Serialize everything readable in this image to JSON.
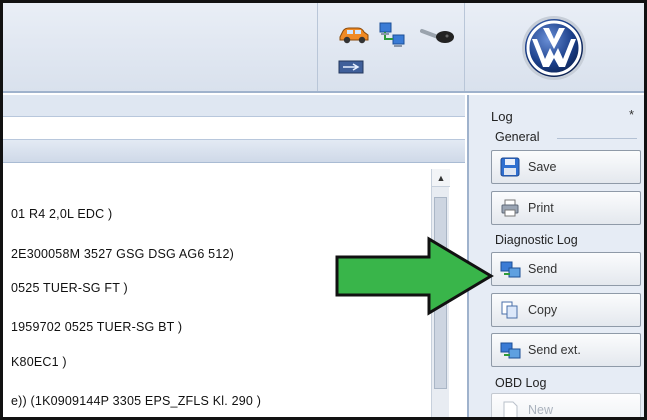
{
  "list": {
    "rows": [
      "01   R4 2,0L EDC  )",
      "2E300058M    3527   GSG DSG AG6    512)",
      "0525   TUER-SG FT  )",
      "1959702    0525   TUER-SG BT  )",
      "K80EC1  )",
      "e)) (1K0909144P     3305   EPS_ZFLS Kl. 290  )"
    ]
  },
  "sidebar": {
    "title": "Log",
    "pin_glyph": "*",
    "general_label": "General",
    "diagnostic_label": "Diagnostic Log",
    "obd_label": "OBD Log",
    "buttons": {
      "save": "Save",
      "print": "Print",
      "send": "Send",
      "copy": "Copy",
      "send_ext": "Send ext.",
      "new": "New"
    }
  },
  "colors": {
    "arrow_fill": "#39b54a",
    "arrow_stroke": "#111111",
    "vw_blue": "#1b3f8a"
  },
  "icons": [
    "car-icon",
    "network-icon",
    "key-icon",
    "usb-icon",
    "vw-logo",
    "save-icon",
    "print-icon",
    "send-icon",
    "copy-icon",
    "send-ext-icon",
    "new-icon",
    "scroll-up-icon"
  ]
}
